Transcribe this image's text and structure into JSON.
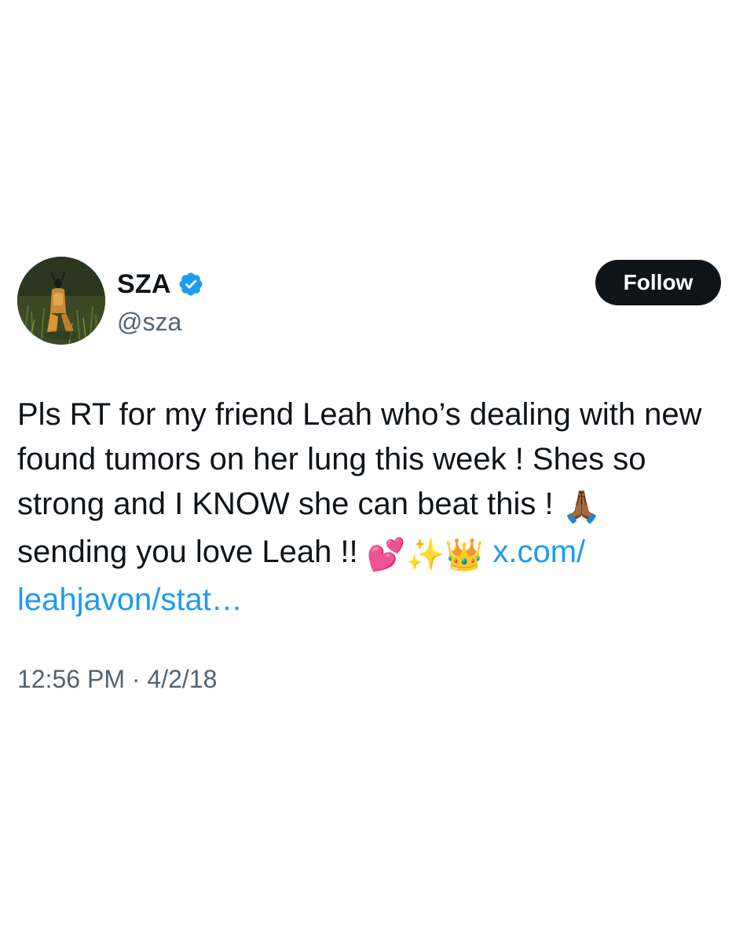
{
  "author": {
    "display_name": "SZA",
    "handle": "@sza",
    "verified": true,
    "avatar_icon": "profile-photo-figure-in-grass"
  },
  "follow_button": {
    "label": "Follow"
  },
  "tweet": {
    "line1": "Pls RT for my friend Leah who’s dealing with new",
    "line2": "found tumors on her lung this week ! Shes so",
    "line3": "strong and I KNOW she can beat this ! ",
    "line3_emoji": "🙏🏾",
    "line4": "sending you love Leah !! ",
    "line4_emojis": [
      "💕",
      "✨",
      "👑"
    ],
    "link_part1": "x.com/",
    "link_part2": "leahjavon/stat…"
  },
  "meta": {
    "time": "12:56 PM",
    "separator": " · ",
    "date": "4/2/18"
  },
  "colors": {
    "text": "#0f1419",
    "secondary": "#536471",
    "link": "#1d9bf0",
    "verified": "#1d9bf0",
    "button_bg": "#0f1419"
  }
}
